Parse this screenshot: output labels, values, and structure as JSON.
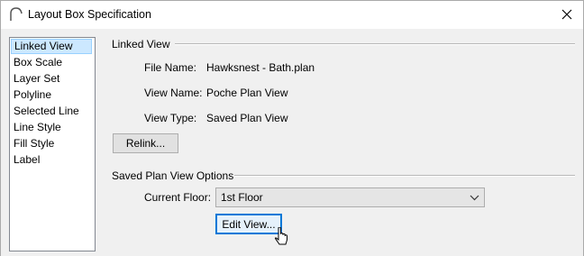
{
  "window": {
    "title": "Layout Box Specification",
    "close_icon": "close-icon",
    "app_icon": "app-arch-icon"
  },
  "sidebar": {
    "items": [
      {
        "label": "Linked View",
        "selected": true
      },
      {
        "label": "Box Scale"
      },
      {
        "label": "Layer Set"
      },
      {
        "label": "Polyline"
      },
      {
        "label": "Selected Line"
      },
      {
        "label": "Line Style"
      },
      {
        "label": "Fill Style"
      },
      {
        "label": "Label"
      }
    ]
  },
  "linked_view": {
    "group_label": "Linked View",
    "file_name_label": "File Name:",
    "file_name_value": "Hawksnest - Bath.plan",
    "view_name_label": "View Name:",
    "view_name_value": "Poche Plan View",
    "view_type_label": "View Type:",
    "view_type_value": "Saved Plan View",
    "relink_button": "Relink..."
  },
  "saved_plan_options": {
    "group_label": "Saved Plan View Options",
    "current_floor_label": "Current Floor:",
    "current_floor_value": "1st Floor",
    "edit_view_button": "Edit View..."
  },
  "colors": {
    "selection_bg": "#cce8ff",
    "selection_border": "#99d1ff",
    "default_button_border": "#0078d7"
  }
}
